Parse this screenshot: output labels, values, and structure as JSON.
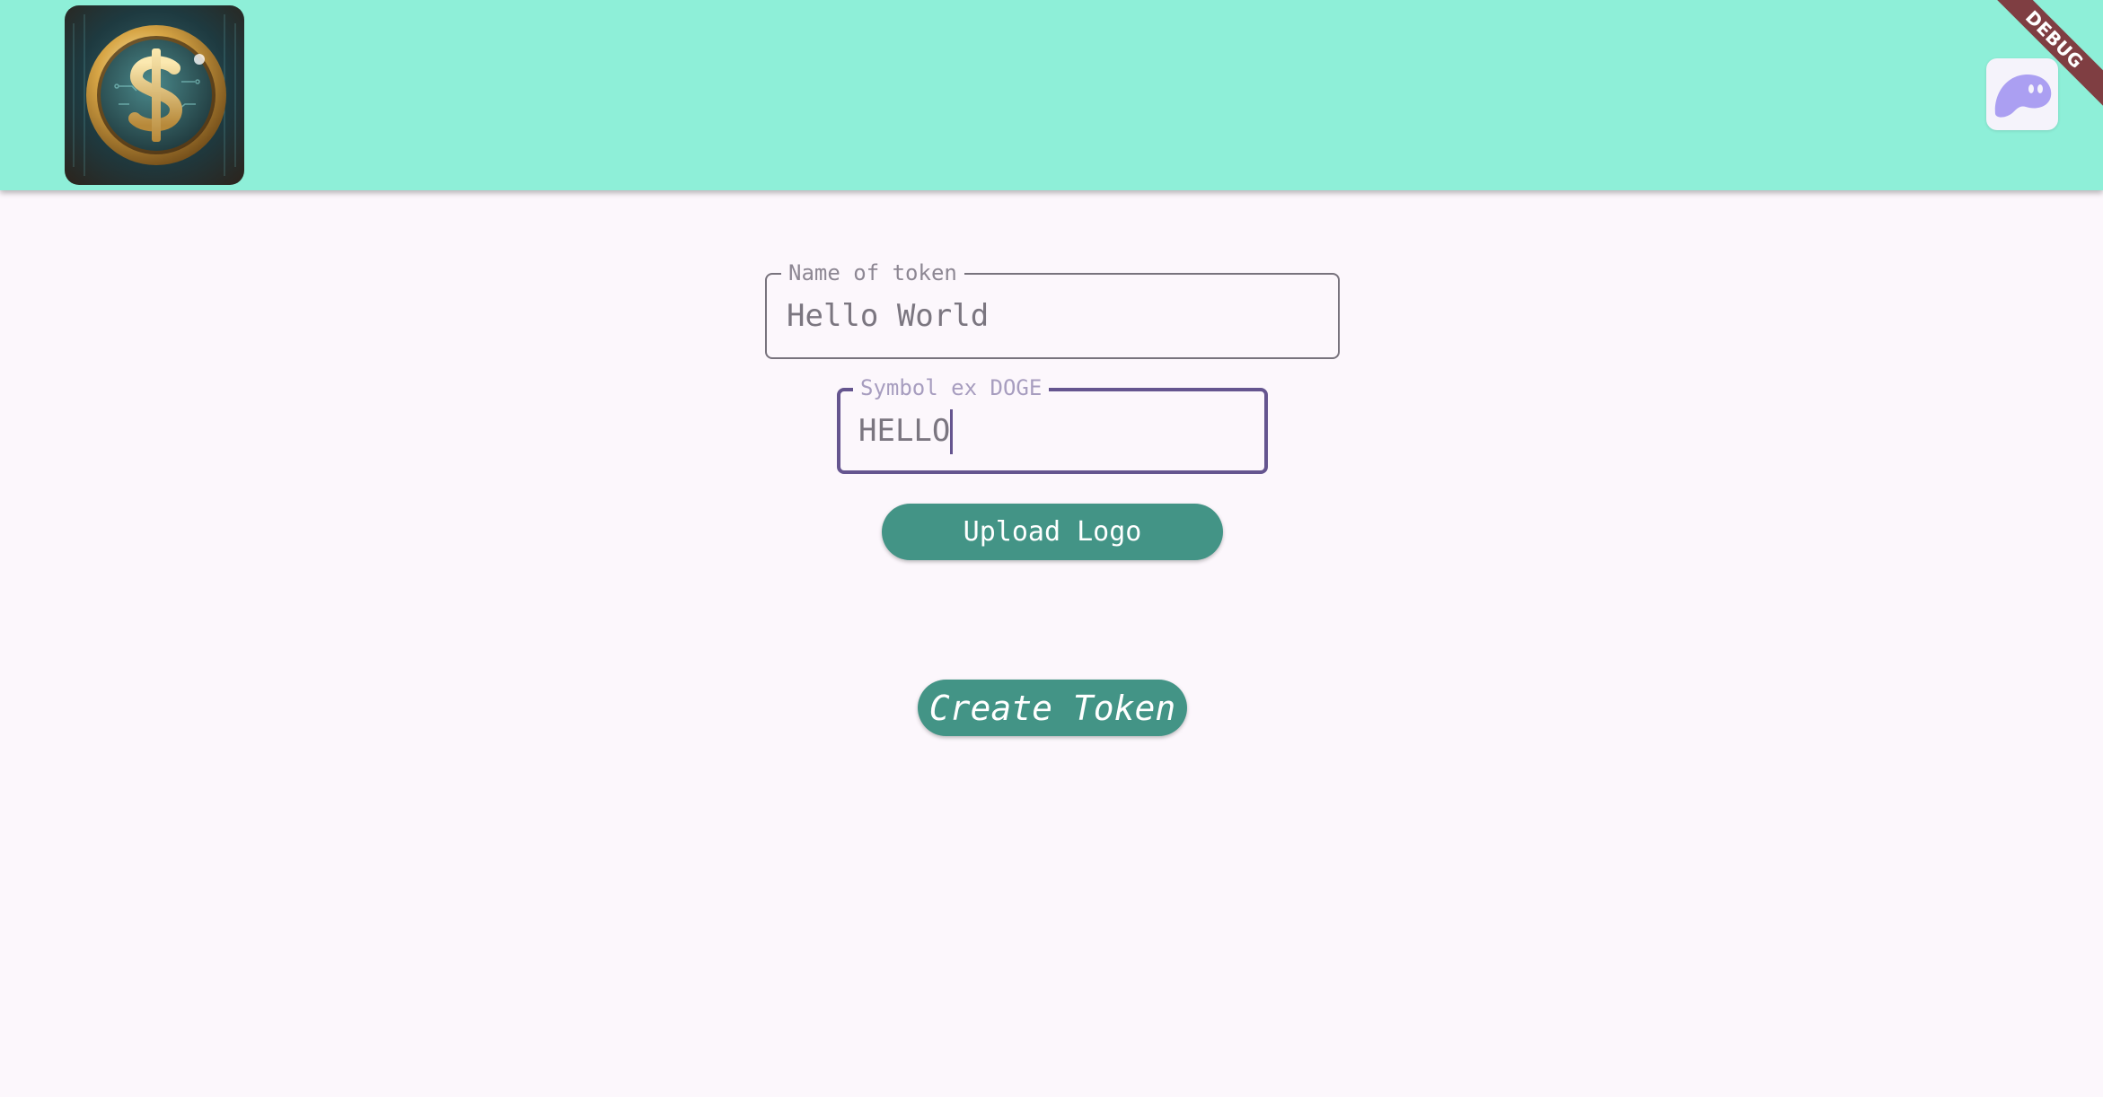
{
  "app_bar": {
    "background": "#8eefd8",
    "logo_icon": "gold-dollar-coin-logo",
    "wallet_icon": "phantom-ghost-icon",
    "wallet_color": "#ab9ff2"
  },
  "debug_banner": {
    "label": "DEBUG"
  },
  "form": {
    "name_field": {
      "label": "Name of token",
      "value": "Hello World"
    },
    "symbol_field": {
      "label": "Symbol ex DOGE",
      "value": "HELLO",
      "focused": true,
      "focus_color": "#65558f"
    },
    "upload_button": {
      "label": "Upload Logo"
    },
    "create_button": {
      "label": "Create Token"
    },
    "button_color": "#439486"
  }
}
